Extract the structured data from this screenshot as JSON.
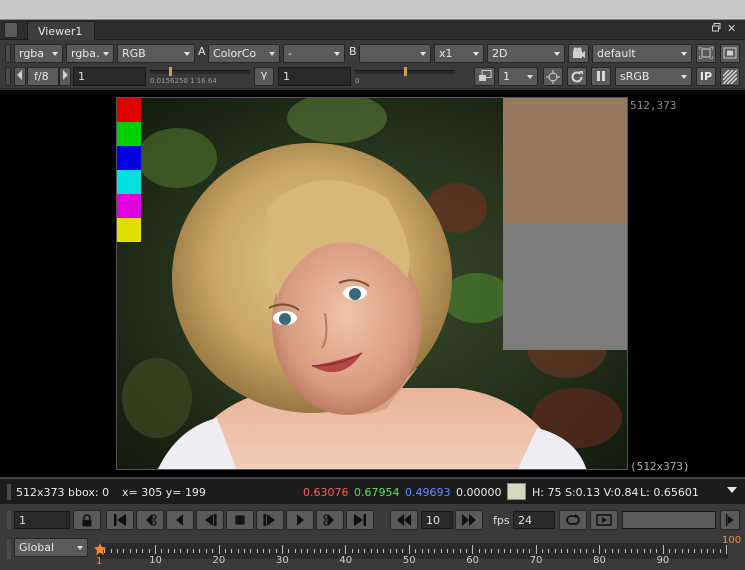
{
  "window": {
    "tab_title": "Viewer1",
    "float_icon": "float-icon",
    "close_glyph": "✕"
  },
  "toolbar1": {
    "channels": "rgba",
    "alpha_channel": "rgba.",
    "layer": "RGB",
    "input_a_label": "A",
    "input_a": "ColorCo",
    "operation": "-",
    "input_b_label": "B",
    "input_b": "",
    "zoom": "x1",
    "view_mode": "2D",
    "camera_icon": "camera-icon",
    "lut": "default",
    "roi_icon": "roi-icon",
    "fullscreen_icon": "fullscreen-icon"
  },
  "toolbar2": {
    "fstop": "f/8",
    "gain": "1",
    "gain_ticks": "0.0156250      1       16 64",
    "gain_level": 0.2,
    "gamma_label": "γ",
    "gamma": "1",
    "gamma_ticks": "0",
    "gamma_level": 0.5,
    "proxy": "1",
    "colorspace": "sRGB",
    "ip_label": "IP"
  },
  "viewer": {
    "top_right_coord": "512,373",
    "bottom_right_format": "(512x373)",
    "swatch_colors": [
      "#e00000",
      "#00d000",
      "#0000e0",
      "#00e0e0",
      "#e000e0",
      "#e0e000"
    ],
    "overlay_top_color": "#957a5e",
    "overlay_bottom_color": "#7c7c7c"
  },
  "info": {
    "format": "512x373 bbox: 0",
    "coords": "x= 305 y= 199",
    "r": "0.63076",
    "g": "0.67954",
    "b": "0.49693",
    "a": "0.00000",
    "hsv": "H: 75 S:0.13 V:0.84",
    "luma": "L: 0.65601",
    "sample_color": "#d6d8bc"
  },
  "playback": {
    "frame": "1",
    "step": "10",
    "fps_label": "fps",
    "fps": "24"
  },
  "timeline": {
    "range_mode": "Global",
    "start": "1",
    "end": "100",
    "ticks": [
      "10",
      "20",
      "30",
      "40",
      "50",
      "60",
      "70",
      "80",
      "90"
    ]
  }
}
